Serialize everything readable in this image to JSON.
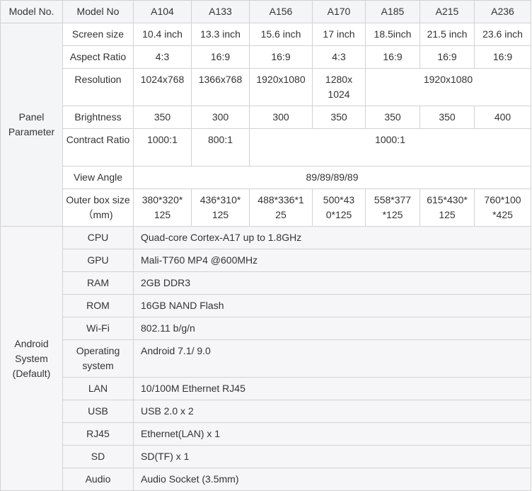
{
  "header": {
    "col0": "Model No.",
    "col1": "Model No",
    "models": [
      "A104",
      "A133",
      "A156",
      "A170",
      "A185",
      "A215",
      "A236"
    ]
  },
  "panel": {
    "group_label": "Panel Parameter",
    "screen_size": {
      "label": "Screen size",
      "values": [
        "10.4 inch",
        "13.3 inch",
        "15.6 inch",
        "17 inch",
        "18.5inch",
        "21.5 inch",
        "23.6 inch"
      ]
    },
    "aspect_ratio": {
      "label": "Aspect Ratio",
      "values": [
        "4:3",
        "16:9",
        "16:9",
        "4:3",
        "16:9",
        "16:9",
        "16:9"
      ]
    },
    "resolution": {
      "label": "Resolution",
      "values": [
        "1024x768",
        "1366x768",
        "1920x1080",
        "1280x 1024",
        "1920x1080"
      ]
    },
    "brightness": {
      "label": "Brightness",
      "values": [
        "350",
        "300",
        "300",
        "350",
        "350",
        "350",
        "400"
      ]
    },
    "contrast": {
      "label": "Contract Ratio",
      "values": [
        "1000:1",
        "800:1",
        "1000:1"
      ]
    },
    "view_angle": {
      "label": "View Angle",
      "value": "89/89/89/89"
    },
    "outer_box": {
      "label": "Outer box size（mm)",
      "values": [
        "380*320* 125",
        "436*310* 125",
        "488*336*1 25",
        "500*43 0*125",
        "558*377 *125",
        "615*430* 125",
        "760*100 *425"
      ]
    }
  },
  "android": {
    "group_label": "Android System (Default)",
    "rows": [
      {
        "label": "CPU",
        "value": "Quad-core Cortex-A17 up to 1.8GHz"
      },
      {
        "label": "GPU",
        "value": "Mali-T760 MP4 @600MHz"
      },
      {
        "label": "RAM",
        "value": "2GB DDR3"
      },
      {
        "label": "ROM",
        "value": "16GB NAND Flash"
      },
      {
        "label": "Wi-Fi",
        "value": "802.11 b/g/n"
      },
      {
        "label": "Operating system",
        "value": "Android 7.1/ 9.0"
      },
      {
        "label": "LAN",
        "value": "10/100M Ethernet RJ45"
      },
      {
        "label": "USB",
        "value": "USB 2.0 x 2"
      },
      {
        "label": "RJ45",
        "value": "Ethernet(LAN) x 1"
      },
      {
        "label": "SD",
        "value": "SD(TF) x 1"
      },
      {
        "label": "Audio",
        "value": "Audio Socket (3.5mm)"
      }
    ]
  }
}
